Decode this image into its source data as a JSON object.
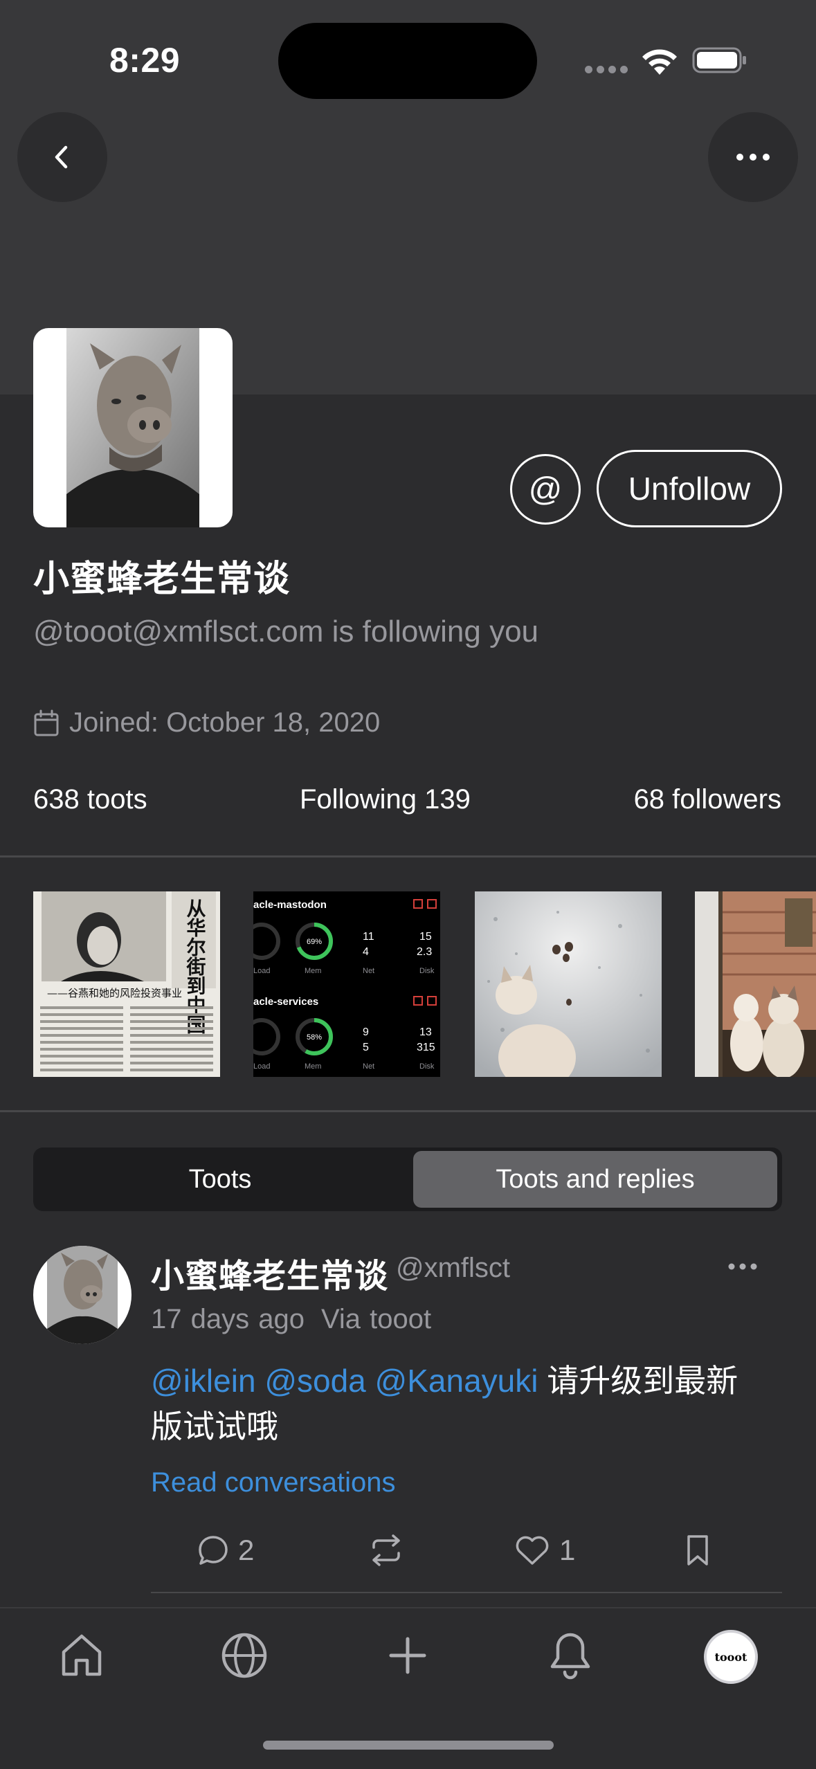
{
  "status_bar": {
    "time": "8:29"
  },
  "profile": {
    "display_name": "小蜜蜂老生常谈",
    "handle_line": "@tooot@xmflsct.com is following you",
    "joined": "Joined: October 18, 2020",
    "unfollow_label": "Unfollow",
    "mention_icon_label": "@",
    "stats": {
      "toots": "638 toots",
      "following": "Following 139",
      "followers": "68 followers"
    }
  },
  "media": {
    "item1": {
      "headline": "从华尔街到中国",
      "subheadline": "——谷燕和她的风险投资事业"
    },
    "item2": {
      "section1": "acle-mastodon",
      "section2": "acle-services",
      "mem1": "69%",
      "mem2": "58%",
      "load_label": "Load",
      "mem_label": "Mem",
      "net_label": "Net",
      "disk_label": "Disk",
      "net1_up": "11",
      "net1_down": "4",
      "disk1_up": "15",
      "disk1_down": "2.3",
      "net2_up": "9",
      "net2_down": "5",
      "disk2_up": "13",
      "disk2_down": "315"
    }
  },
  "tabs": {
    "toots": "Toots",
    "toots_and_replies": "Toots and replies",
    "selected": "Toots and replies"
  },
  "post": {
    "author_name": "小蜜蜂老生常谈",
    "author_handle": "@xmflsct",
    "time_ago": "17 days ago",
    "via": "Via tooot",
    "mentions": [
      "@iklein",
      "@soda",
      "@Kanayuki"
    ],
    "text": "请升级到最新版试试哦",
    "text_part1": "请升级到最新",
    "text_part2": "版试试哦",
    "read_conversations": "Read conversations",
    "reply_count": "2",
    "favourite_count": "1"
  },
  "tab_bar": {
    "items": [
      "home-icon",
      "globe-icon",
      "plus-icon",
      "bell-icon",
      "profile-avatar"
    ],
    "profile_label": "tooot"
  },
  "colors": {
    "background": "#2c2c2e",
    "banner": "#38383a",
    "link": "#3d8fdc",
    "secondary_text": "#98989d"
  }
}
